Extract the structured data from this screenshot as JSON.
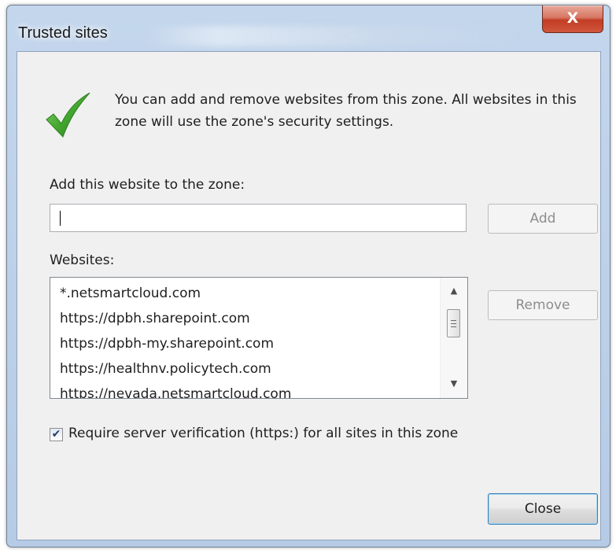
{
  "window": {
    "title": "Trusted sites",
    "close_glyph": "X"
  },
  "info": {
    "icon": "green-checkmark-icon",
    "text": "You can add and remove websites from this zone. All websites in this zone will use the zone's security settings."
  },
  "add": {
    "label": "Add this website to the zone:",
    "value": "",
    "button_label": "Add"
  },
  "websites": {
    "label": "Websites:",
    "items": [
      "*.netsmartcloud.com",
      "https://dpbh.sharepoint.com",
      "https://dpbh-my.sharepoint.com",
      "https://healthnv.policytech.com",
      "https://nevada.netsmartcloud.com"
    ],
    "remove_label": "Remove"
  },
  "verification": {
    "checked": true,
    "label": "Require server verification (https:) for all sites in this zone"
  },
  "footer": {
    "close_label": "Close"
  },
  "colors": {
    "check_green": "#3fa52e",
    "dialog_bg": "#f0f0f0",
    "frame_blue": "#b9cde6",
    "close_red": "#c9432a"
  }
}
